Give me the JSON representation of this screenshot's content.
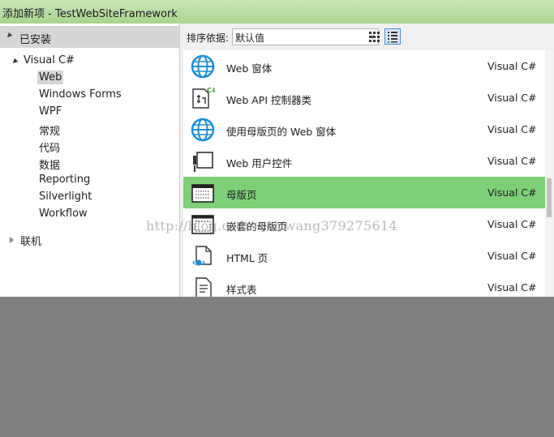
{
  "window": {
    "title": "添加新项 - TestWebSiteFramework"
  },
  "sidebar": {
    "installed_label": "已安装",
    "root": "Visual C#",
    "items": [
      "Web",
      "Windows Forms",
      "WPF",
      "常规",
      "代码",
      "数据",
      "Reporting",
      "Silverlight",
      "Workflow"
    ],
    "selected": "Web",
    "online_label": "联机"
  },
  "toolbar": {
    "sort_label": "排序依据:",
    "sort_value": "默认值",
    "grid_view_icon": "grid-view-icon",
    "list_view_icon": "list-view-icon"
  },
  "templates": [
    {
      "name": "Web 窗体",
      "type": "Visual C#",
      "icon": "globe-icon"
    },
    {
      "name": "Web API 控制器类",
      "type": "Visual C#",
      "icon": "api-controller-icon"
    },
    {
      "name": "使用母版页的 Web 窗体",
      "type": "Visual C#",
      "icon": "globe-icon"
    },
    {
      "name": "Web 用户控件",
      "type": "Visual C#",
      "icon": "user-control-icon"
    },
    {
      "name": "母版页",
      "type": "Visual C#",
      "icon": "master-page-icon"
    },
    {
      "name": "嵌套的母版页",
      "type": "Visual C#",
      "icon": "nested-master-page-icon"
    },
    {
      "name": "HTML 页",
      "type": "Visual C#",
      "icon": "html-page-icon"
    },
    {
      "name": "样式表",
      "type": "Visual C#",
      "icon": "stylesheet-icon"
    }
  ],
  "selected_template": "母版页",
  "watermark": "http://blog.csdn.net/wang379275614",
  "colors": {
    "title_bar": "#b8dca2",
    "selection": "#7ecf77",
    "globe": "#1e8fd6",
    "background": "#808080"
  }
}
